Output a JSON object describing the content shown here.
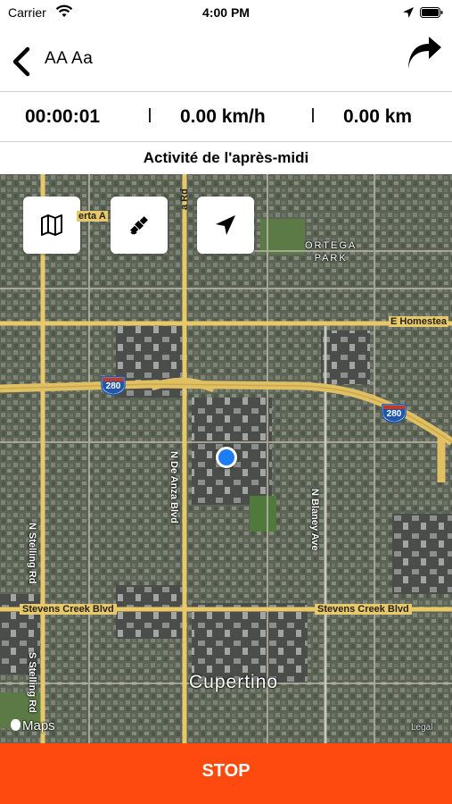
{
  "status_bar": {
    "carrier": "Carrier",
    "time": "4:00 PM"
  },
  "nav": {
    "title": "AA Aa",
    "back_icon": "chevron-left-icon",
    "share_icon": "share-arrow-icon"
  },
  "stats": {
    "duration": "00:00:01",
    "speed": "0.00 km/h",
    "distance": "0.00 km"
  },
  "activity_title": "Activité de l'après-midi",
  "map": {
    "buttons": [
      {
        "icon": "map-icon"
      },
      {
        "icon": "satellite-icon"
      },
      {
        "icon": "location-arrow-icon"
      }
    ],
    "labels": {
      "park": "ORTEGA\nPARK",
      "e_homestead": "E Homestea",
      "serta": "erta A",
      "dearanza_top": "a Rd",
      "n_stelling": "N Stelling Rd",
      "s_stelling": "S Stelling Rd",
      "n_de_anza": "N De Anza Blvd",
      "n_blaney": "N Blaney Ave",
      "stevens_left": "Stevens Creek Blvd",
      "stevens_right": "Stevens Creek Blvd",
      "city": "Cupertino",
      "maps_logo": "Maps",
      "legal": "Legal"
    },
    "shields": [
      "280",
      "280"
    ],
    "colors": {
      "road": "#e8c96a",
      "satellite_base": "#5f6758"
    }
  },
  "stop_button": "STOP",
  "colors": {
    "stop_bg": "#ff4a0f",
    "user_location": "#1e7cf5"
  }
}
